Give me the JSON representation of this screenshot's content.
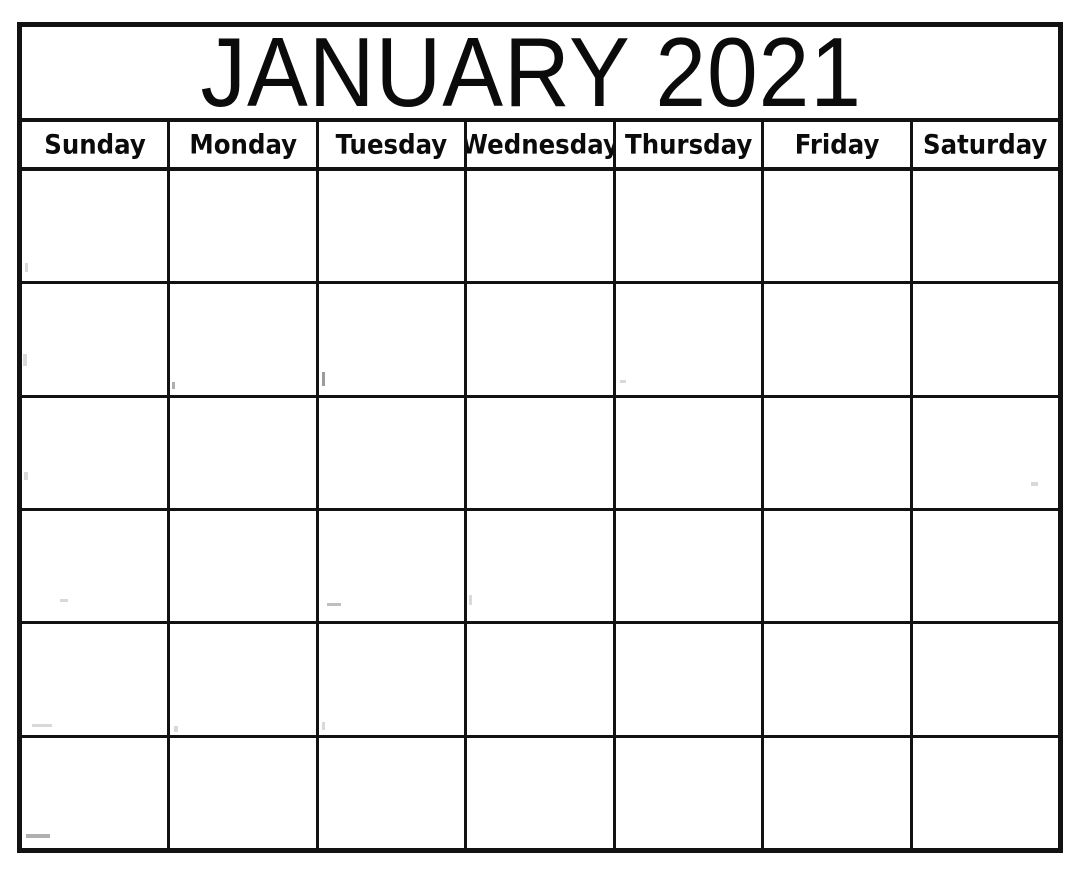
{
  "document": {
    "kind": "printable-monthly-calendar",
    "page_background": "#ffffff",
    "ink_color": "#121212",
    "text_color": "#0b0b0b"
  },
  "calendar": {
    "title": "JANUARY 2021",
    "month": "JANUARY",
    "year": "2021",
    "week_start": "Sunday",
    "weekdays": [
      {
        "label": "Sunday"
      },
      {
        "label": "Monday"
      },
      {
        "label": "Tuesday"
      },
      {
        "label": "Wednesday"
      },
      {
        "label": "Thursday"
      },
      {
        "label": "Friday"
      },
      {
        "label": "Saturday"
      }
    ],
    "weeks": [
      {
        "days": [
          "",
          "",
          "",
          "",
          "",
          "",
          ""
        ]
      },
      {
        "days": [
          "",
          "",
          "",
          "",
          "",
          "",
          ""
        ]
      },
      {
        "days": [
          "",
          "",
          "",
          "",
          "",
          "",
          ""
        ]
      },
      {
        "days": [
          "",
          "",
          "",
          "",
          "",
          "",
          ""
        ]
      },
      {
        "days": [
          "",
          "",
          "",
          "",
          "",
          "",
          ""
        ]
      },
      {
        "days": [
          "",
          "",
          "",
          "",
          "",
          "",
          ""
        ]
      }
    ],
    "row_count": 6,
    "column_count": 7,
    "cells_are_blank": true
  }
}
